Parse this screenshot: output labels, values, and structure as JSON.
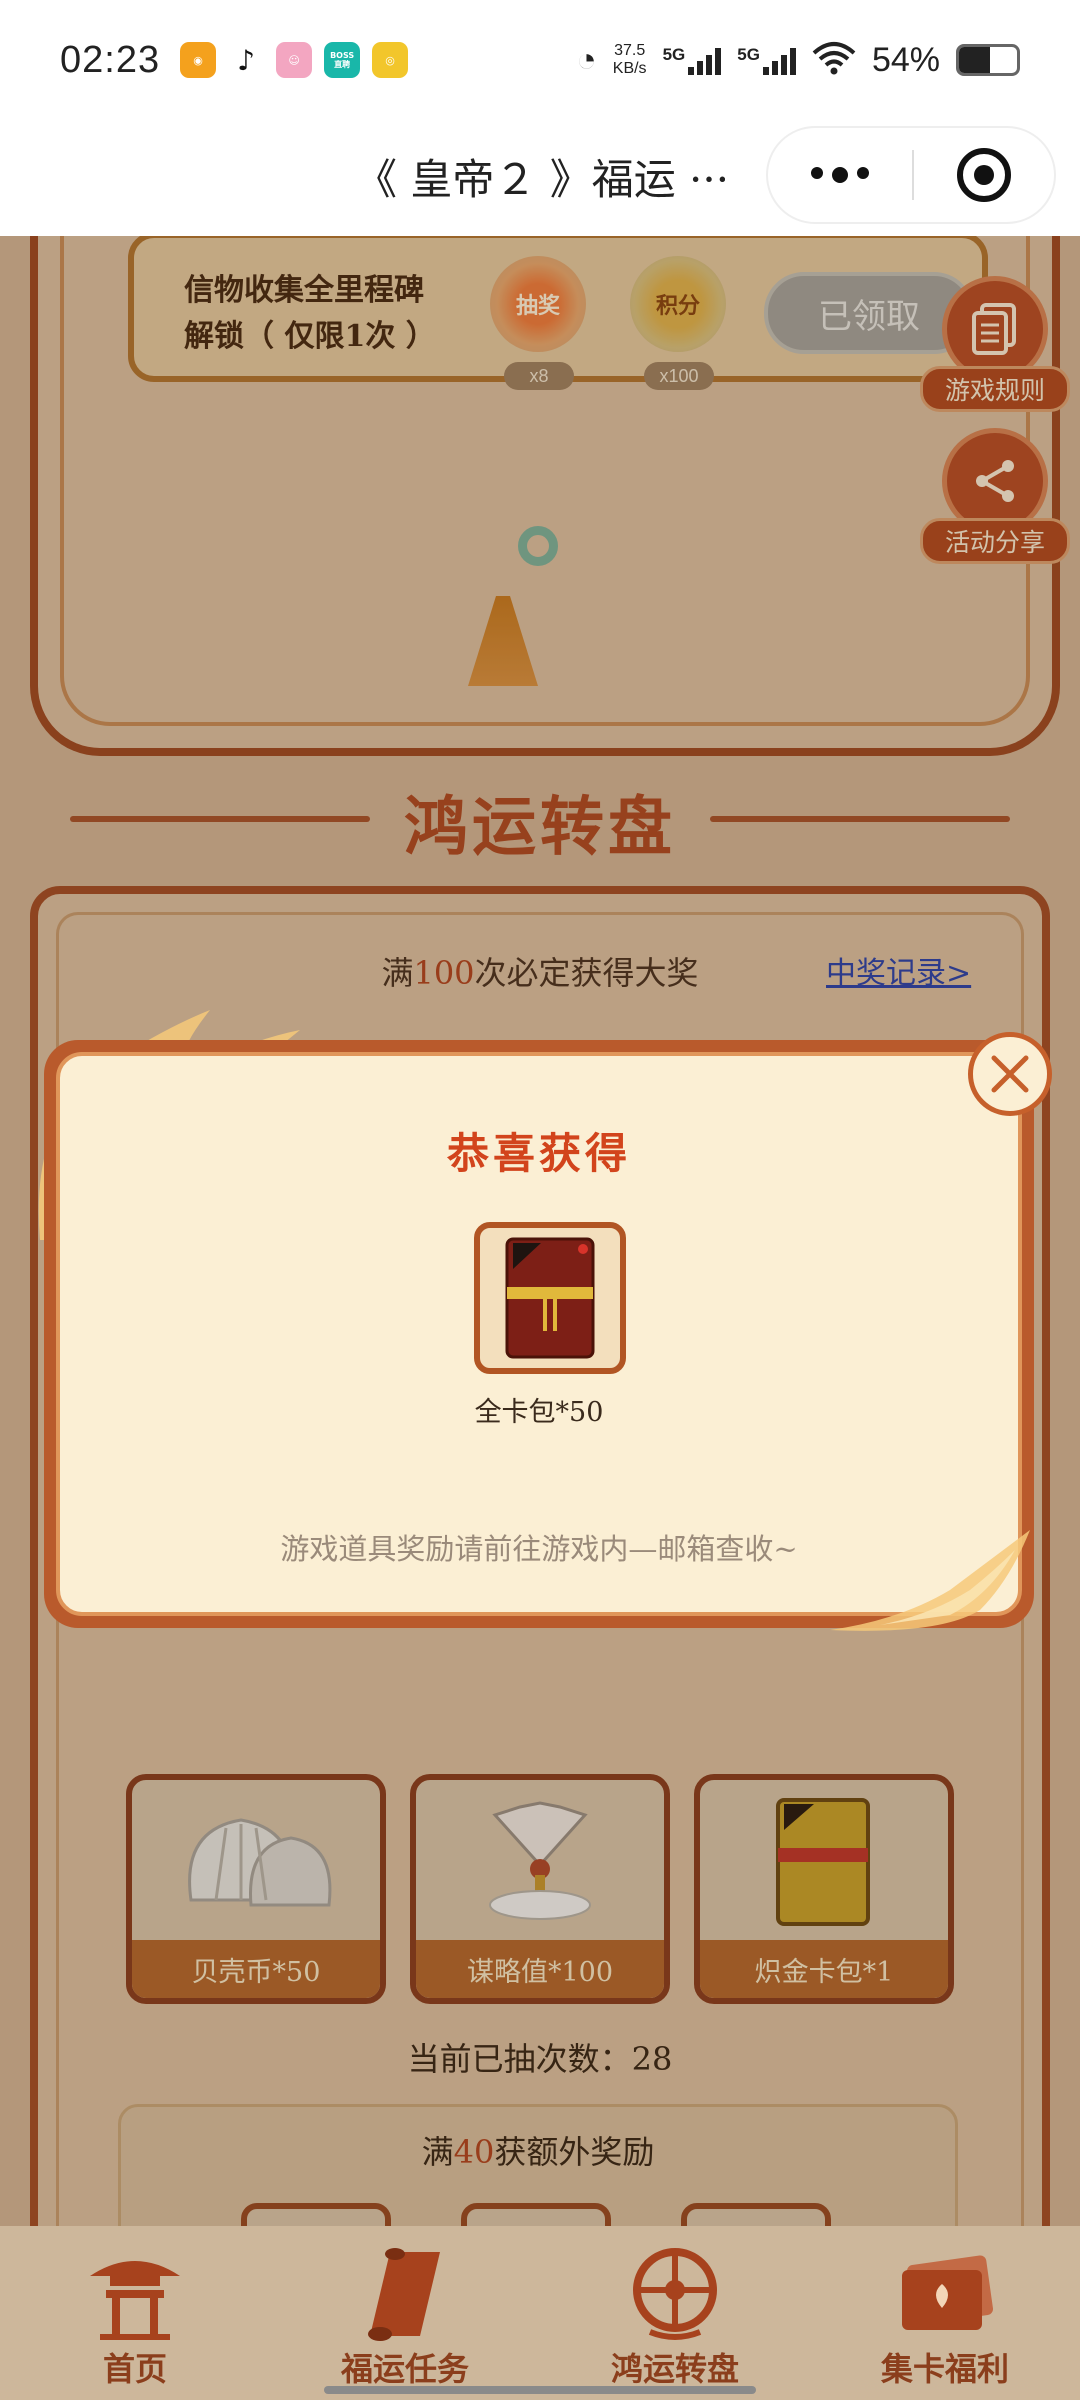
{
  "status_bar": {
    "time": "02:23",
    "net_speed_value": "37.5",
    "net_speed_unit": "KB/s",
    "sim1": "5G",
    "sim2": "5G",
    "battery_pct": "54%",
    "battery_level": 0.54,
    "app_icons": [
      "tencent-video-icon",
      "tiktok-icon",
      "anime-app-icon",
      "boss-zhipin-icon",
      "yellow-app-icon"
    ],
    "boss_line1": "BOSS",
    "boss_line2": "直聘"
  },
  "title_bar": {
    "title": "《 皇帝２ 》福运 ···"
  },
  "collect": {
    "text_line1": "信物收集全里程碑",
    "text_line2": "解锁（ 仅限1次 ）",
    "reward1_label": "抽奖",
    "reward1_count": "x8",
    "reward2_label": "积分",
    "reward2_count": "x100",
    "claimed_label": "已领取"
  },
  "side_buttons": {
    "rules_label": "游戏规则",
    "share_label": "活动分享"
  },
  "wheel": {
    "section_title": "鸿运转盘",
    "guarantee_prefix": "满",
    "guarantee_number": "100",
    "guarantee_suffix": "次必定获得大奖",
    "record_link": "中奖记录>",
    "prizes": [
      {
        "label": "贝壳币*50",
        "icon": "shell-icon"
      },
      {
        "label": "谋略值*100",
        "icon": "feather-fan-icon"
      },
      {
        "label": "炽金卡包*1",
        "icon": "gold-card-pack-icon"
      }
    ],
    "draw_count_label": "当前已抽次数：",
    "draw_count": "28",
    "extra_prefix": "满",
    "extra_number": "40",
    "extra_suffix": "获额外奖励"
  },
  "modal": {
    "title": "恭喜获得",
    "prize_name": "全卡包*50",
    "note": "游戏道具奖励请前往游戏内—邮箱查收~"
  },
  "bottom_nav": [
    {
      "label": "首页",
      "icon": "pagoda-icon"
    },
    {
      "label": "福运任务",
      "icon": "scroll-icon"
    },
    {
      "label": "鸿运转盘",
      "icon": "wheel-icon"
    },
    {
      "label": "集卡福利",
      "icon": "cards-icon"
    }
  ],
  "colors": {
    "accent": "#b04a22",
    "highlight": "#b2451f",
    "modal_title": "#d2441c",
    "link": "#2f43a8"
  }
}
